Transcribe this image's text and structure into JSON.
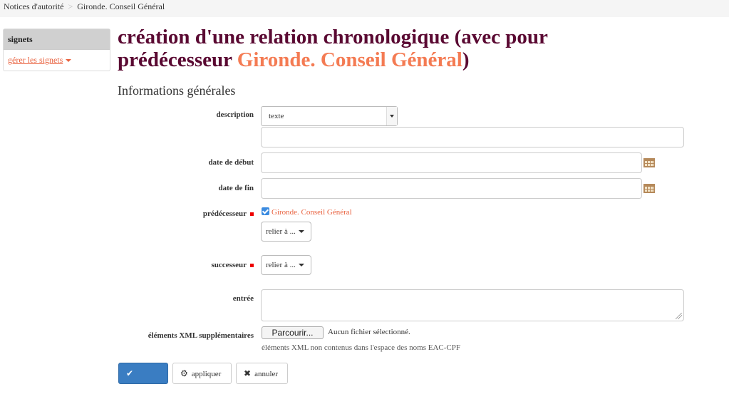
{
  "breadcrumb": {
    "root": "Notices d'autorité",
    "separator": ">",
    "current": "Gironde. Conseil Général"
  },
  "sidebar": {
    "header": "signets",
    "link": "gérer les signets"
  },
  "page": {
    "title_prefix": "création d'une relation chronologique (avec pour prédécesseur ",
    "title_entity": "Gironde. Conseil Général",
    "title_suffix": ")",
    "section": "Informations générales"
  },
  "form": {
    "description": {
      "label": "description",
      "select_value": "texte",
      "text_value": ""
    },
    "start_date": {
      "label": "date de début",
      "value": ""
    },
    "end_date": {
      "label": "date de fin",
      "value": ""
    },
    "predecessor": {
      "label": "prédécesseur",
      "checked": true,
      "checked_label": "Gironde. Conseil Général",
      "relate_button": "relier à ..."
    },
    "successor": {
      "label": "successeur",
      "relate_button": "relier à ..."
    },
    "entry": {
      "label": "entrée",
      "value": ""
    },
    "xml": {
      "label": "éléments XML supplémentaires",
      "browse_button": "Parcourir...",
      "file_status": "Aucun fichier sélectionné.",
      "help": "éléments XML non contenus dans l'espace des noms EAC-CPF"
    }
  },
  "actions": {
    "validate": "valider",
    "apply": "appliquer",
    "cancel": "annuler"
  },
  "icons": {
    "validate": "check-icon",
    "apply": "gear-icon",
    "cancel": "close-icon",
    "date": "calendar-icon"
  },
  "colors": {
    "title": "#5a0932",
    "accent": "#f47b53",
    "link": "#e9623f",
    "primary_button": "#3a7dc2",
    "required_marker": "#e00000"
  }
}
